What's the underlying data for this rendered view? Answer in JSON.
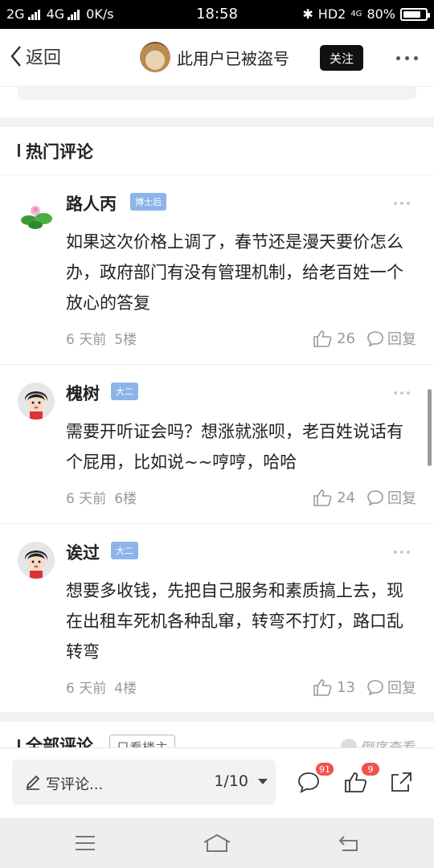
{
  "status_bar": {
    "network1": "2G",
    "network2": "4G",
    "speed": "0K/s",
    "time": "18:58",
    "hd": "HD2",
    "network3": "4G",
    "battery": "80%",
    "battery_level": 0.8
  },
  "nav": {
    "back_label": "返回",
    "username": "此用户已被盗号",
    "follow_label": "关注"
  },
  "hot_section": {
    "title": "热门评论"
  },
  "comments": [
    {
      "name": "路人丙",
      "badge": "博士后",
      "text": "如果这次价格上调了，春节还是漫天要价怎么办，政府部门有没有管理机制，给老百姓一个放心的答复",
      "time": "6 天前",
      "floor": "5楼",
      "likes": "26",
      "reply": "回复"
    },
    {
      "name": "槐树",
      "badge": "大二",
      "text": "需要开听证会吗？想涨就涨呗，老百姓说话有个屁用，比如说~~哼哼，哈哈",
      "time": "6 天前",
      "floor": "6楼",
      "likes": "24",
      "reply": "回复"
    },
    {
      "name": "诶过",
      "badge": "大二",
      "text": "想要多收钱，先把自己服务和素质搞上去，现在出租车死机各种乱窜，转弯不打灯，路口乱转弯",
      "time": "6 天前",
      "floor": "4楼",
      "likes": "13",
      "reply": "回复"
    }
  ],
  "all_section": {
    "title": "全部评论",
    "filter": "只看楼主",
    "sort": "倒序查看"
  },
  "input_bar": {
    "placeholder": "写评论...",
    "page": "1/10",
    "comment_count": "91",
    "like_count": "9"
  },
  "colors": {
    "badge": "#8db4e8",
    "notify": "#f0524f",
    "follow_bg": "#111111"
  }
}
